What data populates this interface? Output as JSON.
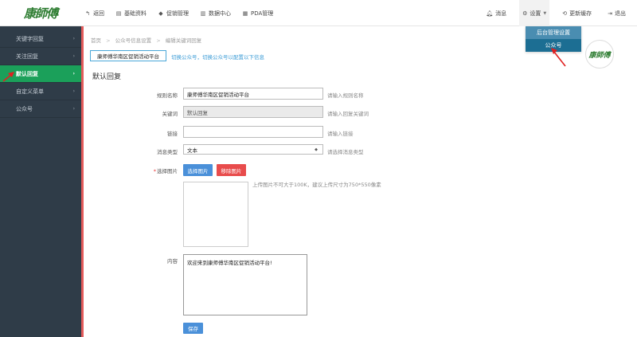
{
  "brand": {
    "logo_text": "康師傅"
  },
  "topnav": [
    {
      "icon": "back-arrow-icon",
      "glyph": "↰",
      "label": "返回"
    },
    {
      "icon": "document-icon",
      "glyph": "▤",
      "label": "基础资料"
    },
    {
      "icon": "tag-icon",
      "glyph": "◆",
      "label": "促销管理"
    },
    {
      "icon": "bar-chart-icon",
      "glyph": "▥",
      "label": "数据中心"
    },
    {
      "icon": "barcode-icon",
      "glyph": "▦",
      "label": "PDA管理"
    }
  ],
  "topright": {
    "messages_label": "消息",
    "settings_label": "设置",
    "refresh_label": "更新缓存",
    "logout_label": "退出"
  },
  "settings_dropdown": {
    "items": [
      "后台管理设置",
      "公众号"
    ],
    "selected": "公众号"
  },
  "avatar": {
    "text": "康師傅"
  },
  "sidebar": {
    "items": [
      {
        "label": "关键字回复",
        "active": false
      },
      {
        "label": "关注回复",
        "active": false
      },
      {
        "label": "默认回复",
        "active": true
      },
      {
        "label": "自定义菜单",
        "active": false
      },
      {
        "label": "公众号",
        "active": false
      }
    ]
  },
  "breadcrumb": [
    "首页",
    "公众号信息设置",
    "编辑关键词回复"
  ],
  "account": {
    "current": "康师傅华南区促销活动平台",
    "switch_tip": "切换公众号，切换公众号以配置以下信息"
  },
  "section_title": "默认回复",
  "form": {
    "rule_name": {
      "label": "规则名称",
      "value": "康师傅华南区促销活动平台",
      "hint": "请输入规则名称"
    },
    "keyword": {
      "label": "关键词",
      "value": "默认回复",
      "hint": "请输入回复关键词"
    },
    "link": {
      "label": "链接",
      "value": "",
      "hint": "请输入链接"
    },
    "msg_type": {
      "label": "消息类型",
      "value": "文本",
      "hint": "请选择消息类型"
    },
    "image": {
      "label": "选择图片",
      "choose_button": "选择图片",
      "remove_button": "移除图片",
      "hint": "上传图片不可大于100K，建议上传尺寸为750*550像素"
    },
    "content": {
      "label": "内容",
      "value": "欢迎来到康师傅华南区促销活动平台!"
    },
    "save_button": "保存"
  },
  "colors": {
    "sidebar_bg": "#2f3c48",
    "sidebar_active": "#1ba05a",
    "accent_blue": "#4a90d9",
    "danger_red": "#e84c4c",
    "dropdown_blue": "#4a8db1"
  }
}
